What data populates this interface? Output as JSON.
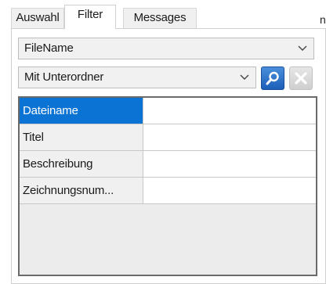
{
  "tabs": [
    {
      "label": "Auswahl",
      "active": false
    },
    {
      "label": "Filter",
      "active": true
    },
    {
      "label": "Messages",
      "active": false
    }
  ],
  "stray_mark": "n",
  "filters": {
    "field_select": {
      "value": "FileName"
    },
    "scope_select": {
      "value": "Mit Unterordner"
    }
  },
  "buttons": {
    "search_icon": "search-icon",
    "clear_icon": "close-icon"
  },
  "properties": [
    {
      "name": "Dateiname",
      "value": "",
      "selected": true
    },
    {
      "name": "Titel",
      "value": "",
      "selected": false
    },
    {
      "name": "Beschreibung",
      "value": "",
      "selected": false
    },
    {
      "name": "Zeichnungsnum...",
      "value": "",
      "selected": false
    }
  ],
  "colors": {
    "selection": "#0b73d4",
    "search_button": "#1c5fb8"
  }
}
